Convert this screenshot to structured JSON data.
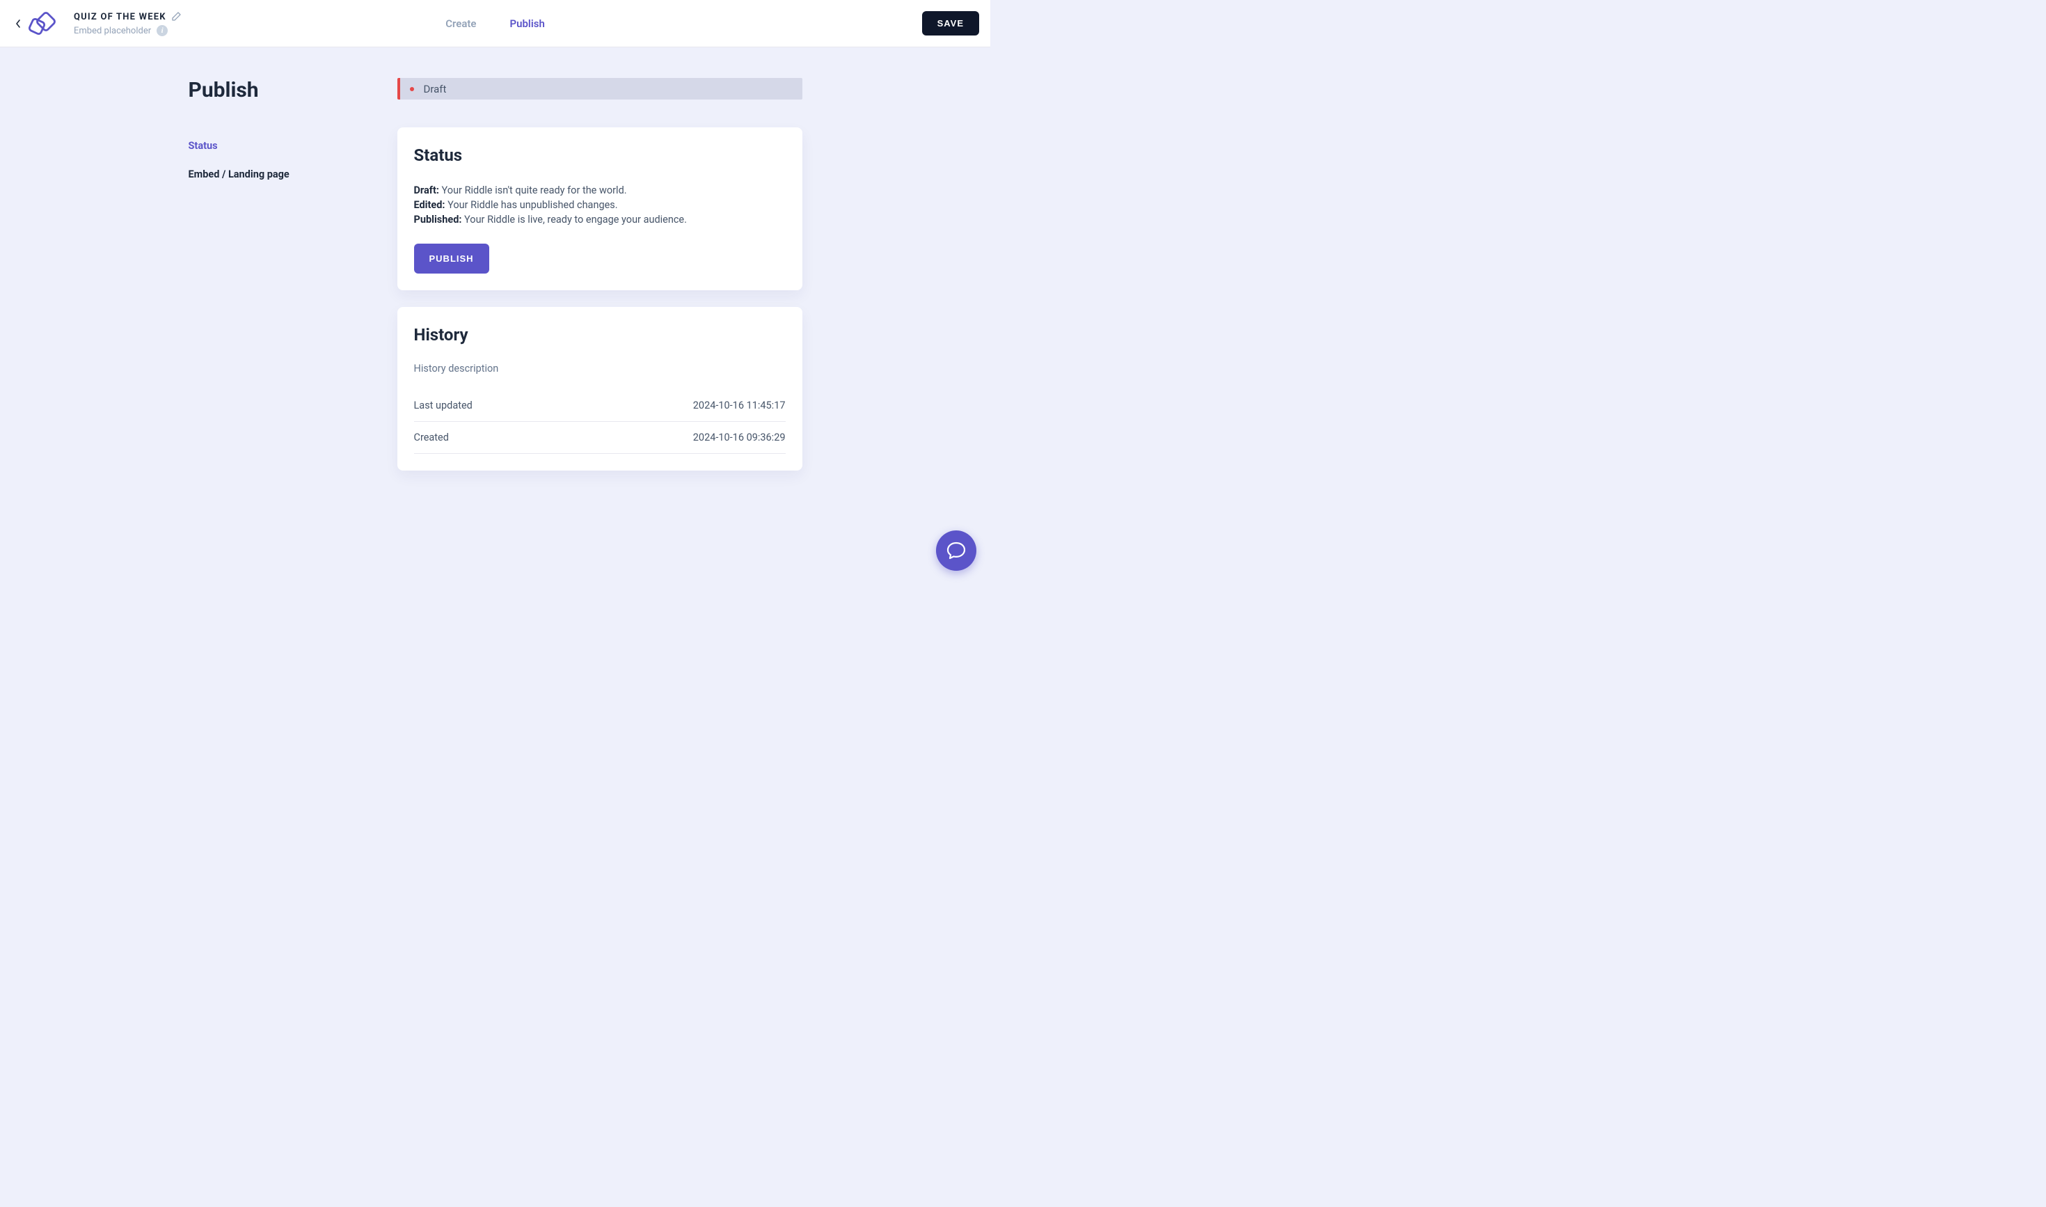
{
  "header": {
    "title": "QUIZ OF THE WEEK",
    "subtitle": "Embed placeholder",
    "save_label": "SAVE"
  },
  "nav": {
    "create_label": "Create",
    "publish_label": "Publish"
  },
  "sidebar": {
    "page_title": "Publish",
    "items": [
      {
        "label": "Status",
        "active": true
      },
      {
        "label": "Embed / Landing page",
        "active": false
      }
    ]
  },
  "status_banner": {
    "text": "Draft"
  },
  "status_card": {
    "title": "Status",
    "lines": [
      {
        "label": "Draft:",
        "text": " Your Riddle isn't quite ready for the world."
      },
      {
        "label": "Edited:",
        "text": " Your Riddle has unpublished changes."
      },
      {
        "label": "Published:",
        "text": " Your Riddle is live, ready to engage your audience."
      }
    ],
    "publish_button": "PUBLISH"
  },
  "history_card": {
    "title": "History",
    "description": "History description",
    "rows": [
      {
        "label": "Last updated",
        "value": "2024-10-16 11:45:17"
      },
      {
        "label": "Created",
        "value": "2024-10-16 09:36:29"
      }
    ]
  }
}
